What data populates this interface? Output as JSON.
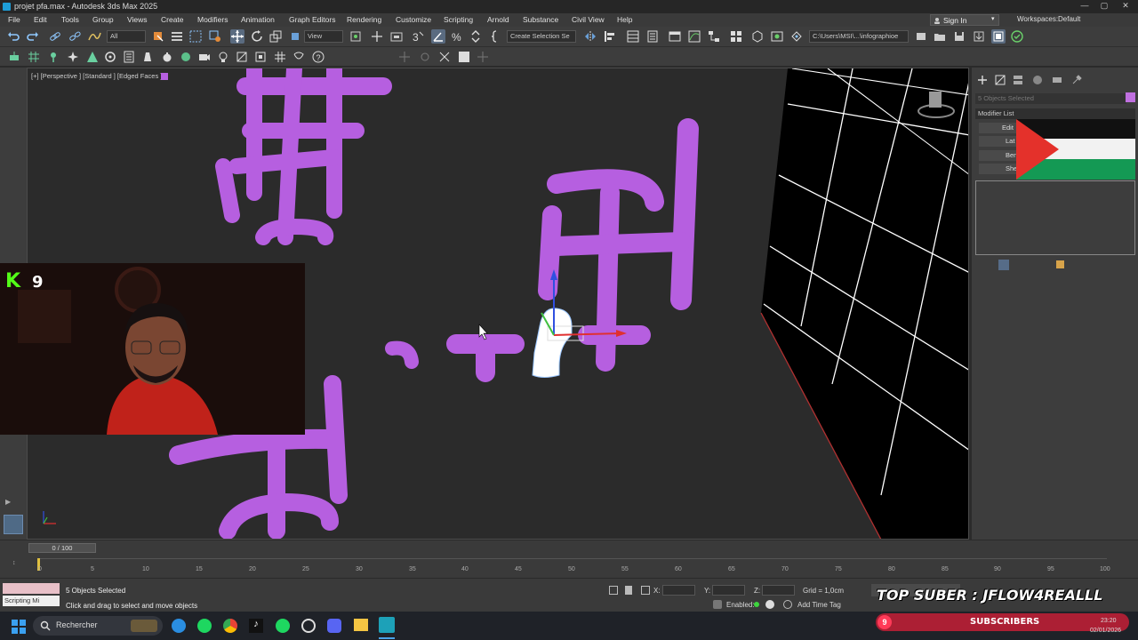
{
  "window": {
    "title": "projet pfa.max - Autodesk 3ds Max 2025",
    "controls": [
      "—",
      "▢",
      "✕"
    ]
  },
  "menu": {
    "items": [
      "File",
      "Edit",
      "Tools",
      "Group",
      "Views",
      "Create",
      "Modifiers",
      "Animation",
      "Graph Editors",
      "Rendering",
      "Customize",
      "Scripting",
      "Arnold",
      "Substance",
      "Civil View",
      "Help"
    ],
    "sign_in": "Sign In",
    "workspaces_label": "Workspaces:",
    "workspaces_value": "Default"
  },
  "toolbar": {
    "filter_value": "All",
    "view_value": "View",
    "selection_set_placeholder": "Create Selection Se",
    "path_value": "C:\\Users\\MSI\\...\\infographioe"
  },
  "viewport": {
    "label": "[+] [Perspective ] [Standard ] [Edged Faces ]",
    "mesh_color": "#b65fe0",
    "wire_color": "#ffffff"
  },
  "command_panel": {
    "objects_selected": "5 Objects Selected",
    "modifier_list": "Modifier List",
    "stack_items": [
      "Edit",
      "Lat",
      "Ben",
      "She"
    ]
  },
  "webcam": {
    "kick_letter": "K",
    "viewers": "9"
  },
  "timeline": {
    "frame_display": "0 / 100",
    "ticks": [
      "0",
      "5",
      "10",
      "15",
      "20",
      "25",
      "30",
      "35",
      "40",
      "45",
      "50",
      "55",
      "60",
      "65",
      "70",
      "75",
      "80",
      "85",
      "90",
      "95",
      "100"
    ]
  },
  "status": {
    "selection": "5 Objects Selected",
    "prompt": "Click and drag to select and move objects",
    "scripting_label": "Scripting Mi",
    "x_label": "X:",
    "y_label": "Y:",
    "z_label": "Z:",
    "grid": "Grid = 1,0cm",
    "enabled_label": "Enabled:",
    "add_time_tag": "Add Time Tag",
    "overlay_banner": "TOP SUBER : JFLOW4REALLL",
    "subscribers_count": "9",
    "subscribers_label": "SUBSCRIBERS"
  },
  "taskbar": {
    "search_placeholder": "Rechercher",
    "time": "23:20",
    "date": "02/01/2026"
  }
}
